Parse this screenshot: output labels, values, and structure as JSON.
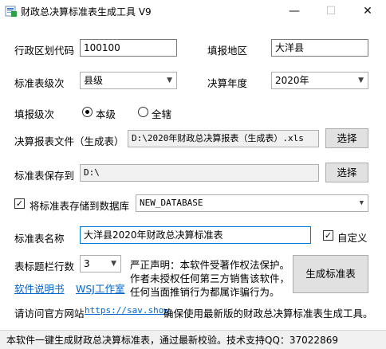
{
  "window": {
    "title": "财政总决算标准表生成工具 V9",
    "minimize": "—",
    "maximize": "☐",
    "close": "✕"
  },
  "form": {
    "region_code_label": "行政区划代码",
    "region_code_value": "100100",
    "fill_area_label": "填报地区",
    "fill_area_value": "大洋县",
    "std_level_label": "标准表级次",
    "std_level_value": "县级",
    "year_label": "决算年度",
    "year_value": "2020年",
    "fill_level_label": "填报级次",
    "radio_this_level": "本级",
    "radio_all": "全辖",
    "report_file_label": "决算报表文件（生成表）",
    "report_file_value": "D:\\2020年财政总决算报表（生成表）.xls",
    "choose_label": "选择",
    "save_to_label": "标准表保存到",
    "save_to_value": "D:\\",
    "store_db_label": "将标准表存储到数据库",
    "db_value": "NEW_DATABASE",
    "std_name_label": "标准表名称",
    "std_name_value": "大洋县2020年财政总决算标准表",
    "custom_label": "自定义",
    "header_rows_label": "表标题栏行数",
    "header_rows_value": "3",
    "manual_link": "软件说明书",
    "studio_link": "WSJ工作室",
    "declaration_line1": "严正声明：本软件受著作权法保护。",
    "declaration_line2": "作者未授权任何第三方销售该软件，",
    "declaration_line3": "任何当面推销行为都属诈骗行为。",
    "generate_button": "生成标准表",
    "visit_prefix": "请访问官方网站",
    "visit_url": "https://sav.show",
    "visit_suffix": "确保使用最新版的财政总决算标准表生成工具。"
  },
  "status": {
    "text": "本软件一键生成财政总决算标准表，通过最新校验。技术支持QQ：37022869"
  },
  "colors": {
    "link": "#0066cc",
    "button_bg": "#e1e1e1",
    "statusbar_bg": "#f0f0f0"
  }
}
